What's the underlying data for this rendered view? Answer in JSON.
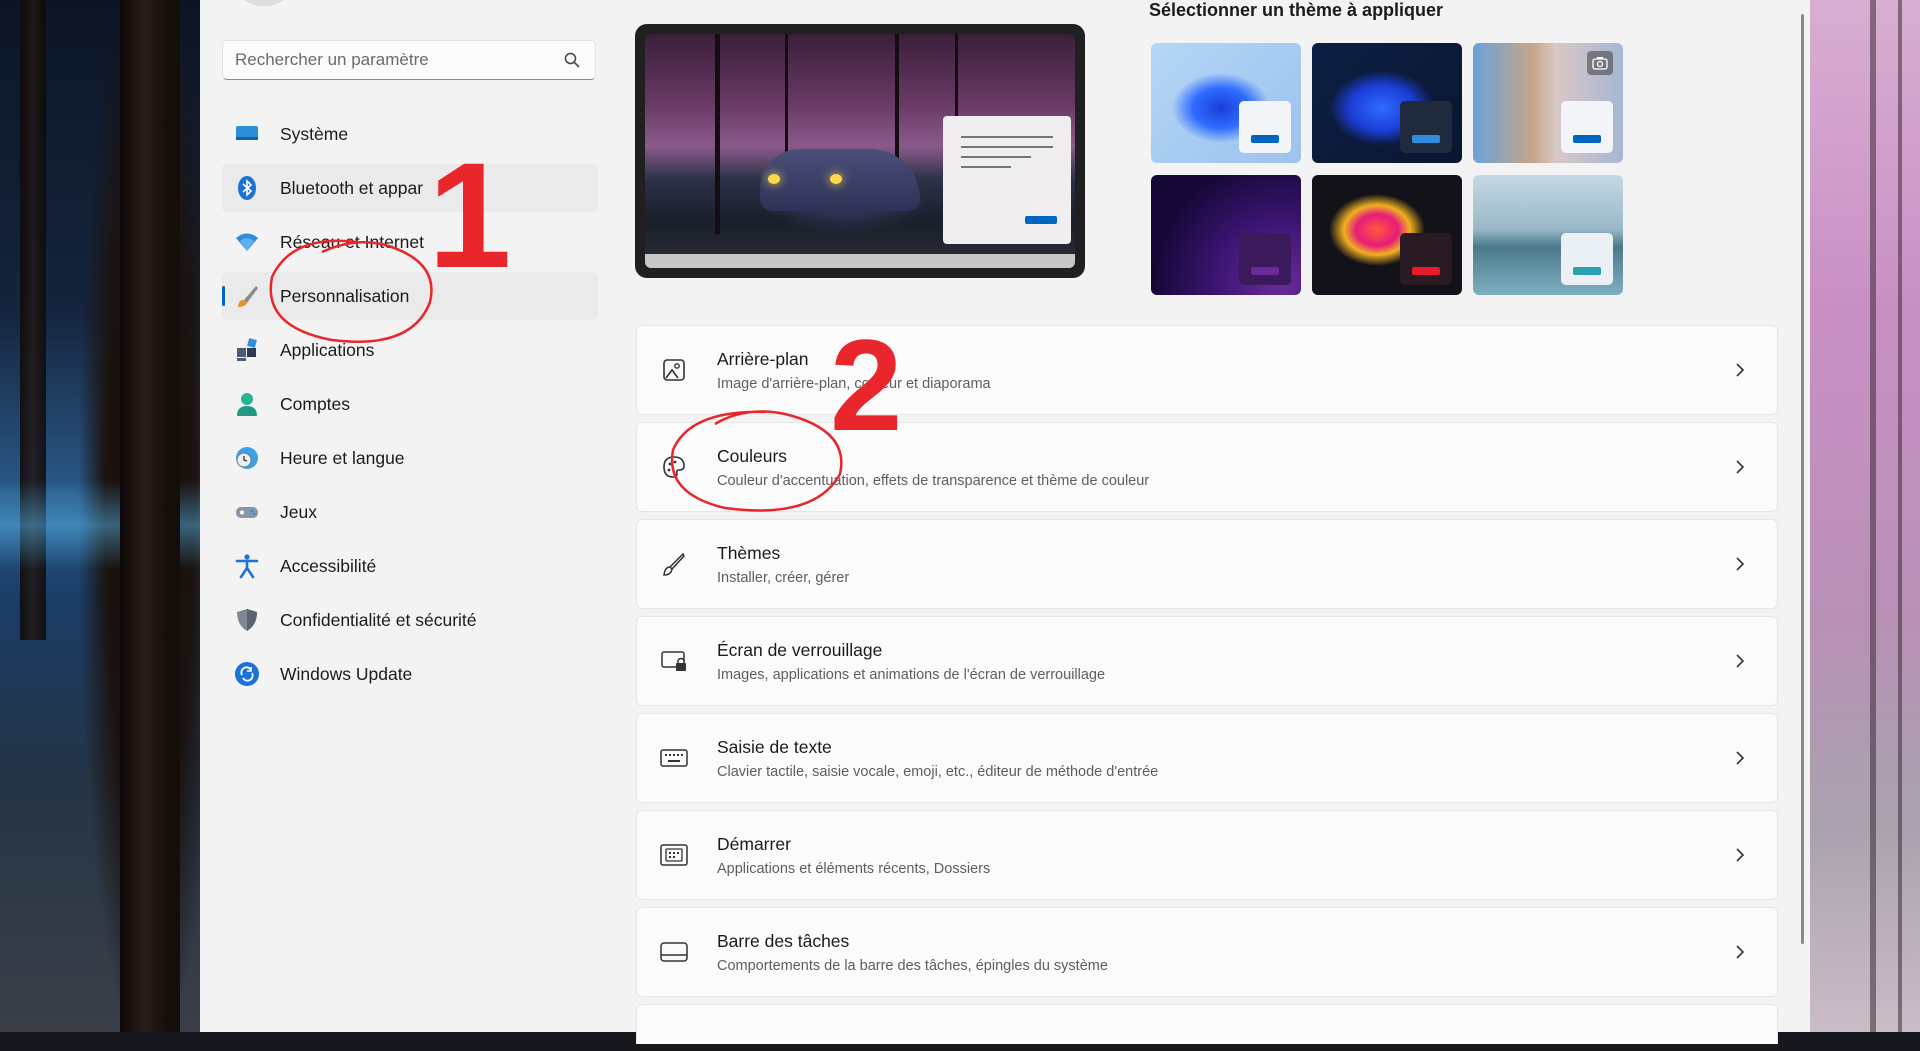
{
  "search": {
    "placeholder": "Rechercher un paramètre"
  },
  "nav": {
    "items": [
      {
        "label": "Système",
        "icon": "monitor-icon"
      },
      {
        "label": "Bluetooth et appar",
        "icon": "bluetooth-icon"
      },
      {
        "label": "Réseau et Internet",
        "icon": "wifi-icon"
      },
      {
        "label": "Personnalisation",
        "icon": "brush-icon"
      },
      {
        "label": "Applications",
        "icon": "apps-icon"
      },
      {
        "label": "Comptes",
        "icon": "account-icon"
      },
      {
        "label": "Heure et langue",
        "icon": "clock-globe-icon"
      },
      {
        "label": "Jeux",
        "icon": "gamepad-icon"
      },
      {
        "label": "Accessibilité",
        "icon": "accessibility-icon"
      },
      {
        "label": "Confidentialité et sécurité",
        "icon": "shield-icon"
      },
      {
        "label": "Windows Update",
        "icon": "update-icon"
      }
    ],
    "selected_index": 3
  },
  "themes": {
    "title": "Sélectionner un thème à appliquer"
  },
  "cards": [
    {
      "title": "Arrière-plan",
      "subtitle": "Image d'arrière-plan, couleur et diaporama",
      "icon": "picture-icon"
    },
    {
      "title": "Couleurs",
      "subtitle": "Couleur d'accentuation, effets de transparence et thème de couleur",
      "icon": "palette-icon"
    },
    {
      "title": "Thèmes",
      "subtitle": "Installer, créer, gérer",
      "icon": "brush-icon"
    },
    {
      "title": "Écran de verrouillage",
      "subtitle": "Images, applications et animations de l'écran de verrouillage",
      "icon": "lock-screen-icon"
    },
    {
      "title": "Saisie de texte",
      "subtitle": "Clavier tactile, saisie vocale, emoji, etc., éditeur de méthode d'entrée",
      "icon": "keyboard-icon"
    },
    {
      "title": "Démarrer",
      "subtitle": "Applications et éléments récents, Dossiers",
      "icon": "start-icon"
    },
    {
      "title": "Barre des tâches",
      "subtitle": "Comportements de la barre des tâches, épingles du système",
      "icon": "taskbar-icon"
    }
  ],
  "annotations": {
    "step1": "1",
    "step2": "2"
  },
  "colors": {
    "accent": "#0067c0",
    "annotation_red": "#e8262b"
  }
}
